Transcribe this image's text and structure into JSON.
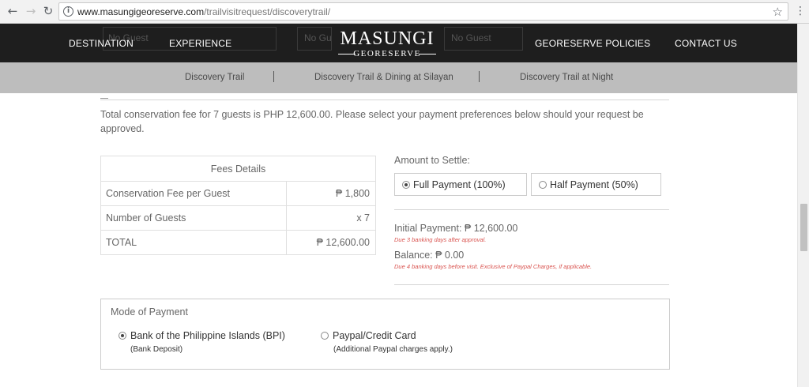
{
  "browser": {
    "url_host": "www.masungigeoreserve.com",
    "url_path": "/trailvisitrequest/discoverytrail/",
    "back_glyph": "←",
    "forward_glyph": "→",
    "reload_glyph": "↻",
    "info_glyph": "i",
    "star_glyph": "☆",
    "menu_glyph": "⋮"
  },
  "nav": {
    "destination": "DESTINATION",
    "experience": "EXPERIENCE",
    "policies": "GEORESERVE POLICIES",
    "contact": "CONTACT US",
    "logo_main": "MASUNGI",
    "logo_sub": "GEORESERVE",
    "behind_1": "No Guest",
    "behind_2": "No Gu",
    "behind_3": "No Guest"
  },
  "subnav": {
    "items": [
      "Discovery Trail",
      "Discovery Trail & Dining at Silayan",
      "Discovery Trail at Night"
    ]
  },
  "intro": "Total conservation fee for 7 guests is PHP 12,600.00. Please select your payment preferences below should your request be approved.",
  "fees": {
    "header": "Fees Details",
    "rows": [
      {
        "label": "Conservation Fee per Guest",
        "value": "₱ 1,800"
      },
      {
        "label": "Number of Guests",
        "value": "x 7"
      },
      {
        "label": "TOTAL",
        "value": "₱ 12,600.00"
      }
    ]
  },
  "settle": {
    "label": "Amount to Settle:",
    "full": "Full Payment (100%)",
    "half": "Half Payment (50%)",
    "selected": "full"
  },
  "payment": {
    "initial": "Initial Payment: ₱ 12,600.00",
    "initial_note": "Due 3 banking days after approval.",
    "balance": "Balance: ₱ 0.00",
    "balance_note": "Due 4 banking days before visit. Exclusive of Paypal Charges, if applicable.",
    "note_color": "#d9534f"
  },
  "mode": {
    "title": "Mode of Payment",
    "bpi": "Bank of the Philippine Islands (BPI)",
    "bpi_sub": "(Bank Deposit)",
    "paypal": "Paypal/Credit Card",
    "paypal_sub": "(Additional Paypal charges apply.)",
    "selected": "bpi"
  }
}
